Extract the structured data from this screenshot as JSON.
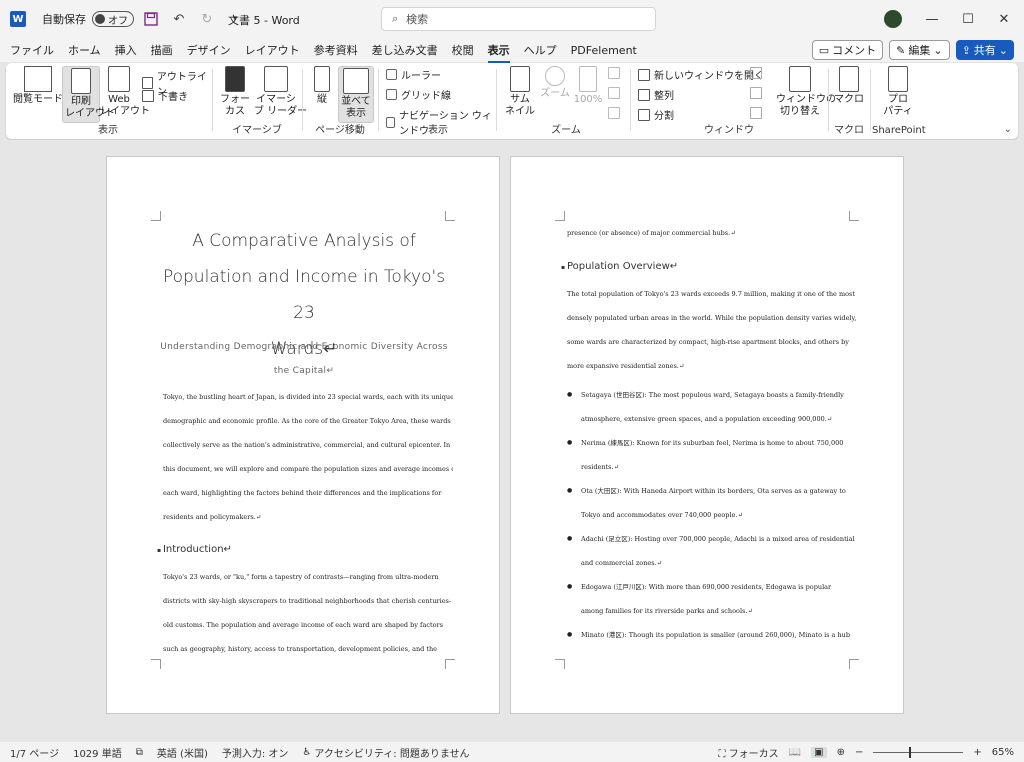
{
  "titlebar": {
    "logo": "W",
    "autosave_label": "自動保存",
    "autosave_state": "オフ",
    "doc_title": "文書 5 - Word",
    "search_placeholder": "検索"
  },
  "menu": {
    "items": [
      "ファイル",
      "ホーム",
      "挿入",
      "描画",
      "デザイン",
      "レイアウト",
      "参考資料",
      "差し込み文書",
      "校閲",
      "表示",
      "ヘルプ",
      "PDFelement"
    ],
    "active_index": 9,
    "comment": "コメント",
    "edit": "編集",
    "share": "共有"
  },
  "ribbon": {
    "view_group": {
      "label": "表示",
      "read_mode": "閲覧モード",
      "print_layout": "印刷\nレイアウト",
      "web_layout": "Web\nレイアウト",
      "outline": "アウトライン",
      "draft": "下書き"
    },
    "immersive_group": {
      "label": "イマーシブ",
      "focus": "フォー\nカス",
      "immersive_reader": "イマーシ\nブ リーダー"
    },
    "page_move_group": {
      "label": "ページ移動",
      "vertical": "縦",
      "side_by_side": "並べて\n表示"
    },
    "show_group": {
      "label": "表示",
      "ruler": "ルーラー",
      "gridlines": "グリッド線",
      "nav_pane": "ナビゲーション ウィンドウ"
    },
    "zoom_group": {
      "label": "ズーム",
      "thumbnail": "サム\nネイル",
      "zoom": "ズーム",
      "hundred": "100%"
    },
    "window_group": {
      "label": "ウィンドウ",
      "new_window": "新しいウィンドウを開く",
      "arrange_all": "整列",
      "split": "分割",
      "switch_windows": "ウィンドウの\n切り替え"
    },
    "macro_group": {
      "label": "マクロ",
      "macro": "マクロ"
    },
    "sharepoint_group": {
      "label": "SharePoint",
      "properties": "プロ\nパティ"
    }
  },
  "page1": {
    "title_lines": [
      "A Comparative Analysis of",
      "Population and Income in Tokyo's 23",
      "Wards↵"
    ],
    "subtitle_lines": [
      "Understanding Demographic and Economic Diversity Across",
      "the Capital↵"
    ],
    "intro_lines": [
      "Tokyo, the bustling heart of Japan, is divided into 23 special wards, each with its unique",
      "demographic and economic profile. As the core of the Greater Tokyo Area, these wards",
      "collectively serve as the nation's administrative, commercial, and cultural epicenter. In",
      "this document, we will explore and compare the population sizes and average incomes of",
      "each ward, highlighting the factors behind their differences and the implications for",
      "residents and policymakers.↵"
    ],
    "heading": "Introduction↵",
    "section_lines": [
      "Tokyo's 23 wards, or \"ku,\" form a tapestry of contrasts—ranging from ultra-modern",
      "districts with sky-high skyscrapers to traditional neighborhoods that cherish centuries-",
      "old customs. The population and average income of each ward are shaped by factors",
      "such as geography, history, access to transportation, development policies, and the"
    ]
  },
  "page2": {
    "top_line": "presence (or absence) of major commercial hubs.↵",
    "heading": "Population Overview↵",
    "para_lines": [
      "The total population of Tokyo's 23 wards exceeds 9.7 million, making it one of the most",
      "densely populated urban areas in the world. While the population density varies widely,",
      "some wards are characterized by compact, high-rise apartment blocks, and others by",
      "more expansive residential zones.↵"
    ],
    "bullets": [
      [
        "Setagaya (世田谷区): The most populous ward, Setagaya boasts a family-friendly",
        "atmosphere, extensive green spaces, and a population exceeding 900,000.↵"
      ],
      [
        "Nerima (練馬区): Known for its suburban feel, Nerima is home to about 750,000",
        "residents.↵"
      ],
      [
        "Ota (大田区): With Haneda Airport within its borders, Ota serves as a gateway to",
        "Tokyo and accommodates over 740,000 people.↵"
      ],
      [
        "Adachi (足立区): Hosting over 700,000 people, Adachi is a mixed area of residential",
        "and commercial zones.↵"
      ],
      [
        "Edogawa (江戸川区): With more than 690,000 residents, Edogawa is popular",
        "among families for its riverside parks and schools.↵"
      ],
      [
        "Minato (港区): Though its population is smaller (around 260,000), Minato is a hub"
      ]
    ]
  },
  "status": {
    "page": "1/7 ページ",
    "words": "1029 単語",
    "language": "英語 (米国)",
    "predict": "予測入力: オン",
    "accessibility": "アクセシビリティ: 問題ありません",
    "focus": "フォーカス",
    "zoom": "65%",
    "zoom_fraction": 0.65
  }
}
